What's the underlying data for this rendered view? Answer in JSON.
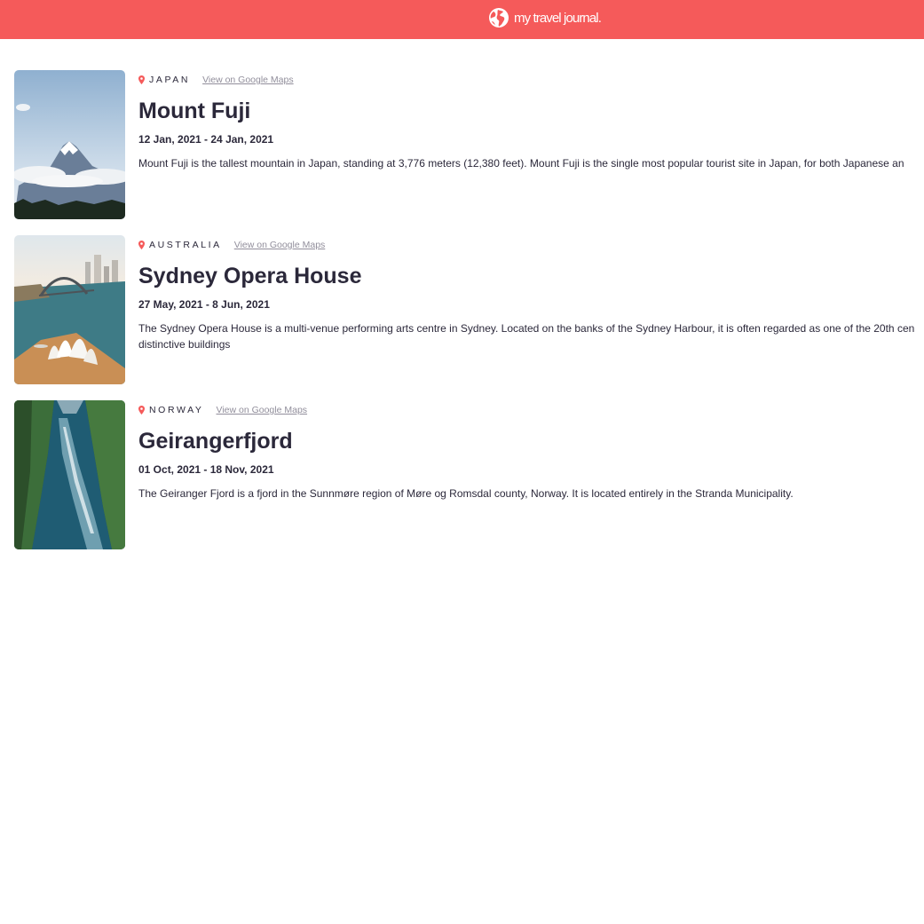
{
  "header": {
    "logo_icon": "globe-icon",
    "title": "my travel journal.",
    "background": "#f55a5a"
  },
  "entries": [
    {
      "country": "JAPAN",
      "maps_link": "View on Google Maps",
      "title": "Mount Fuji",
      "dates": "12 Jan, 2021 - 24 Jan, 2021",
      "description": "Mount Fuji is the tallest mountain in Japan, standing at 3,776 meters (12,380 feet). Mount Fuji is the single most popular tourist site in Japan, for both Japanese an"
    },
    {
      "country": "AUSTRALIA",
      "maps_link": "View on Google Maps",
      "title": "Sydney Opera House",
      "dates": "27 May, 2021 - 8 Jun, 2021",
      "description_line1": "The Sydney Opera House is a multi-venue performing arts centre in Sydney. Located on the banks of the Sydney Harbour, it is often regarded as one of the 20th cen",
      "description_line2": "distinctive buildings"
    },
    {
      "country": "NORWAY",
      "maps_link": "View on Google Maps",
      "title": "Geirangerfjord",
      "dates": "01 Oct, 2021 - 18 Nov, 2021",
      "description": "The Geiranger Fjord is a fjord in the Sunnmøre region of Møre og Romsdal county, Norway. It is located entirely in the Stranda Municipality."
    }
  ],
  "icons": {
    "location": "location-pin-icon"
  },
  "colors": {
    "accent": "#f55a5a",
    "text": "#2b283a",
    "link": "#918e9b"
  }
}
